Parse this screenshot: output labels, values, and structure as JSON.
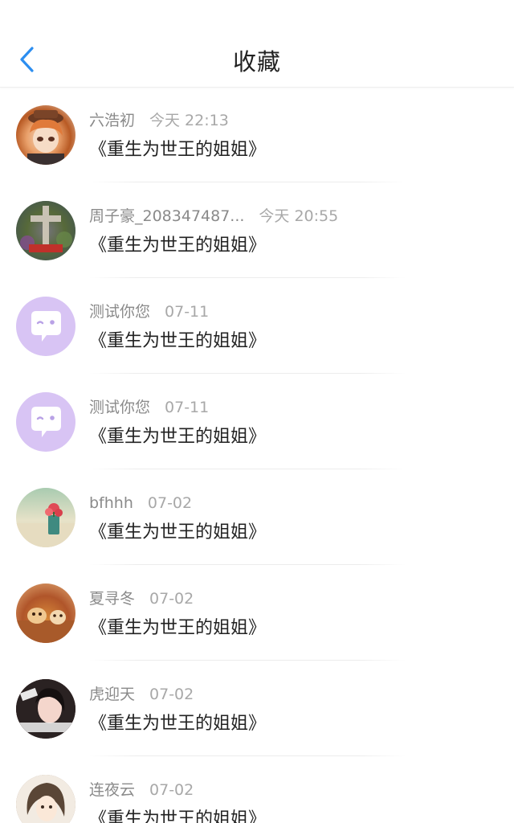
{
  "header": {
    "title": "收藏",
    "back_icon": "chevron-left-icon",
    "accent_color": "#2c8ef0"
  },
  "items": [
    {
      "name": "六浩初",
      "time": "今天 22:13",
      "book": "《重生为世王的姐姐》",
      "avatar": "photo-avatar"
    },
    {
      "name": "周子豪_208347487...",
      "time": "今天 20:55",
      "book": "《重生为世王的姐姐》",
      "avatar": "photo-avatar"
    },
    {
      "name": "测试你您",
      "time": "07-11",
      "book": "《重生为世王的姐姐》",
      "avatar": "chat-bubble-icon"
    },
    {
      "name": "测试你您",
      "time": "07-11",
      "book": "《重生为世王的姐姐》",
      "avatar": "chat-bubble-icon"
    },
    {
      "name": "bfhhh",
      "time": "07-02",
      "book": "《重生为世王的姐姐》",
      "avatar": "photo-avatar"
    },
    {
      "name": "夏寻冬",
      "time": "07-02",
      "book": "《重生为世王的姐姐》",
      "avatar": "photo-avatar"
    },
    {
      "name": "虎迎天",
      "time": "07-02",
      "book": "《重生为世王的姐姐》",
      "avatar": "photo-avatar"
    },
    {
      "name": "连夜云",
      "time": "07-02",
      "book": "《重生为世王的姐姐》",
      "avatar": "photo-avatar"
    }
  ]
}
